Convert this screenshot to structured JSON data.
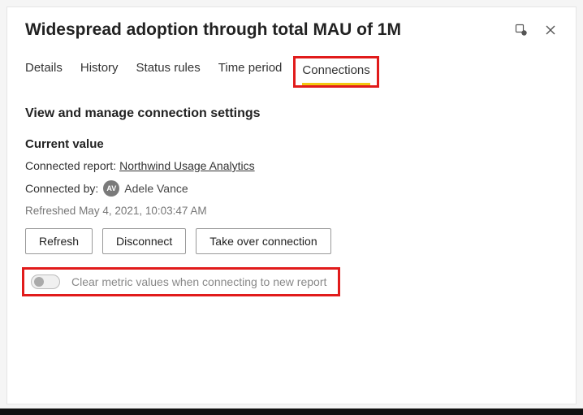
{
  "header": {
    "title": "Widespread adoption through total MAU of 1M"
  },
  "tabs": {
    "items": [
      {
        "label": "Details"
      },
      {
        "label": "History"
      },
      {
        "label": "Status rules"
      },
      {
        "label": "Time period"
      },
      {
        "label": "Connections"
      }
    ]
  },
  "section": {
    "title": "View and manage connection settings",
    "current_value_label": "Current value",
    "connected_report_label": "Connected report:",
    "connected_report_name": "Northwind Usage Analytics",
    "connected_by_label": "Connected by:",
    "connected_by_initials": "AV",
    "connected_by_name": "Adele Vance",
    "refreshed_label": "Refreshed",
    "refreshed_value": "May 4, 2021, 10:03:47 AM"
  },
  "buttons": {
    "refresh": "Refresh",
    "disconnect": "Disconnect",
    "take_over": "Take over connection"
  },
  "toggle": {
    "label": "Clear metric values when connecting to new report"
  }
}
